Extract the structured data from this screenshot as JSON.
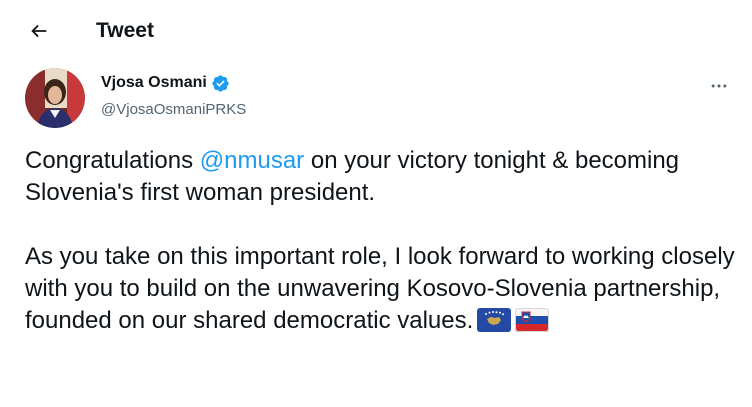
{
  "header": {
    "title": "Tweet",
    "back_icon": "arrow-left-icon"
  },
  "author": {
    "display_name": "Vjosa Osmani",
    "handle": "@VjosaOsmaniPRKS",
    "verified": true,
    "verified_icon": "verified-badge-icon",
    "verified_color": "#1d9bf0"
  },
  "tweet": {
    "para1_before": "Congratulations ",
    "mention": "@nmusar",
    "para1_after": " on your victory tonight & becoming Slovenia's first woman president.",
    "para2": "As you take on this important role, I look forward to working closely with you to build on the unwavering Kosovo-Slovenia partnership, founded on our shared democratic values.",
    "emojis": [
      "flag-kosovo-icon",
      "flag-slovenia-icon"
    ]
  },
  "colors": {
    "text": "#0f1419",
    "secondary": "#536471",
    "link": "#1d9bf0"
  },
  "more_icon": "more-horizontal-icon"
}
